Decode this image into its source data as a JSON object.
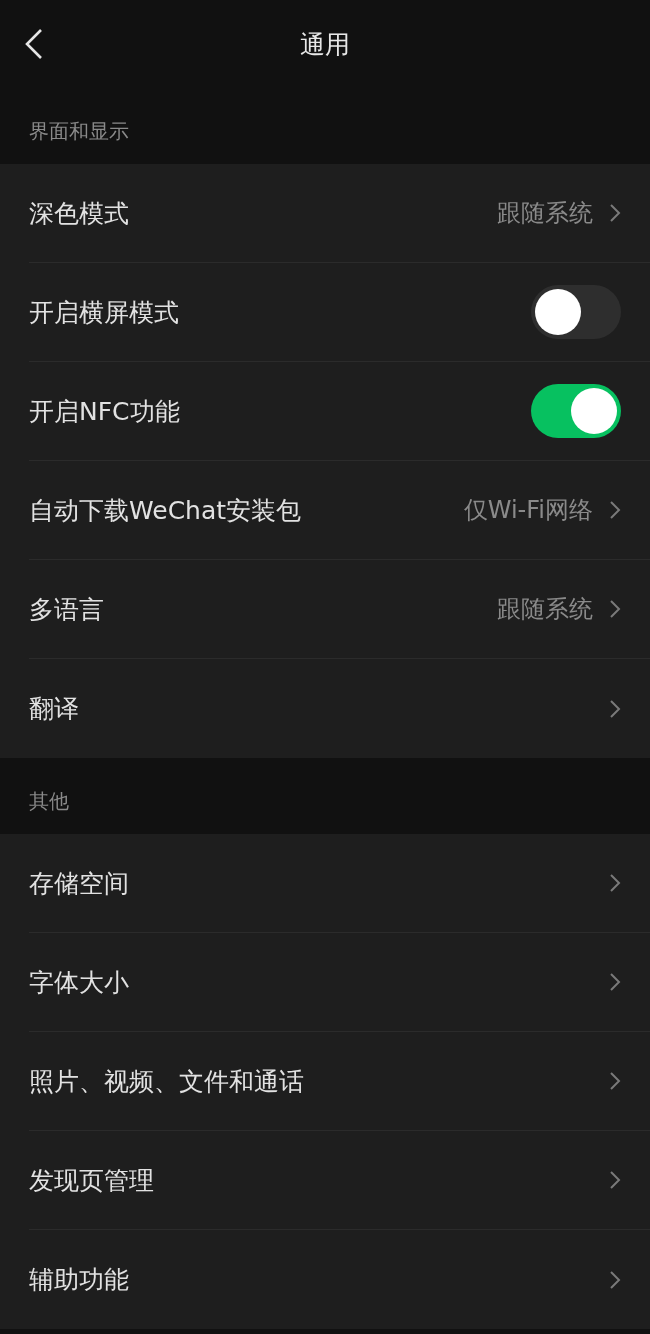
{
  "header": {
    "title": "通用"
  },
  "sections": [
    {
      "title": "界面和显示",
      "items": [
        {
          "kind": "link",
          "label": "深色模式",
          "value": "跟随系统"
        },
        {
          "kind": "toggle",
          "label": "开启横屏模式",
          "on": false
        },
        {
          "kind": "toggle",
          "label": "开启NFC功能",
          "on": true
        },
        {
          "kind": "link",
          "label": "自动下载WeChat安装包",
          "value": "仅Wi-Fi网络"
        },
        {
          "kind": "link",
          "label": "多语言",
          "value": "跟随系统"
        },
        {
          "kind": "link",
          "label": "翻译"
        }
      ]
    },
    {
      "title": "其他",
      "items": [
        {
          "kind": "link",
          "label": "存储空间"
        },
        {
          "kind": "link",
          "label": "字体大小"
        },
        {
          "kind": "link",
          "label": "照片、视频、文件和通话"
        },
        {
          "kind": "link",
          "label": "发现页管理"
        },
        {
          "kind": "link",
          "label": "辅助功能"
        }
      ]
    }
  ]
}
